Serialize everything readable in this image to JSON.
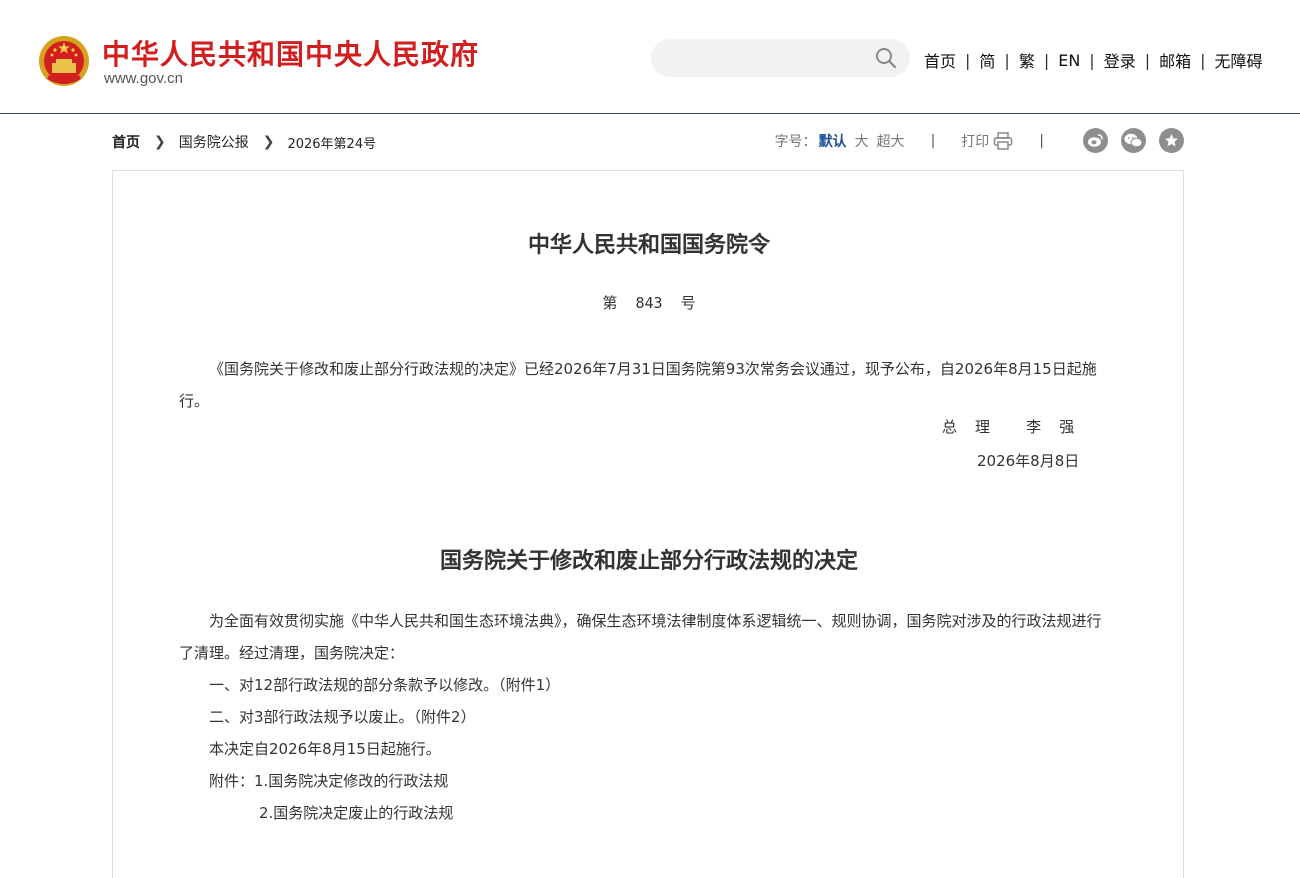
{
  "header": {
    "site_title": "中华人民共和国中央人民政府",
    "site_url": "www.gov.cn",
    "search": {
      "placeholder": "",
      "value": ""
    },
    "nav": [
      "首页",
      "简",
      "繁",
      "EN",
      "登录",
      "邮箱",
      "无障碍"
    ]
  },
  "breadcrumb": {
    "home": "首页",
    "section": "国务院公报",
    "issue": "2026年第24号"
  },
  "toolbar": {
    "font_size_label": "字号：",
    "font_default": "默认",
    "font_large": "大",
    "font_xlarge": "超大",
    "print": "打印",
    "share_icons": [
      "weibo-icon",
      "wechat-icon",
      "favorite-icon"
    ]
  },
  "article": {
    "order_title": "中华人民共和国国务院令",
    "order_number": "第  843  号",
    "order_body": "《国务院关于修改和废止部分行政法规的决定》已经2026年7月31日国务院第93次常务会议通过，现予公布，自2026年8月15日起施行。",
    "signer": "总  理    李  强",
    "sign_date": "2026年8月8日",
    "decision_title": "国务院关于修改和废止部分行政法规的决定",
    "decision_paragraphs": [
      "为全面有效贯彻实施《中华人民共和国生态环境法典》，确保生态环境法律制度体系逻辑统一、规则协调，国务院对涉及的行政法规进行了清理。经过清理，国务院决定：",
      "一、对12部行政法规的部分条款予以修改。（附件1）",
      "二、对3部行政法规予以废止。（附件2）",
      "本决定自2026年8月15日起施行。",
      "附件：1.国务院决定修改的行政法规"
    ],
    "attachment_2": "2.国务院决定废止的行政法规"
  },
  "colors": {
    "brand_red": "#d11e1e",
    "link_blue": "#1e4f97",
    "icon_gray": "#8e8e8e"
  }
}
